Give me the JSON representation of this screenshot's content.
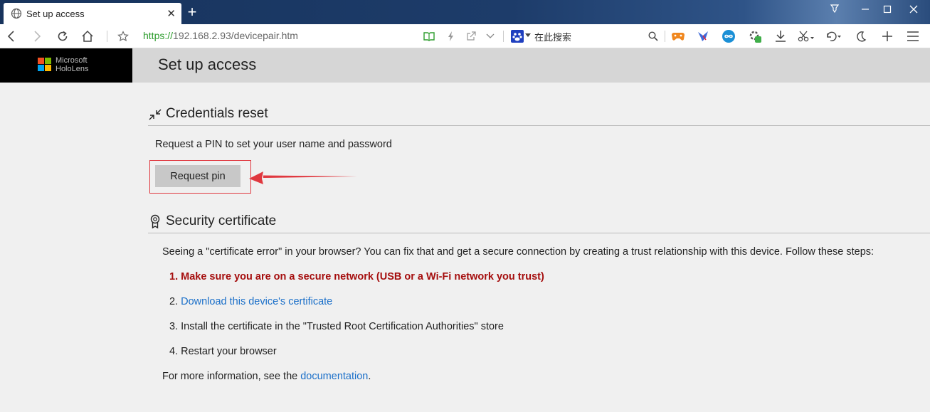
{
  "browser": {
    "tab_title": "Set up access",
    "tab_close": "✕",
    "new_tab": "+",
    "url_proto": "https://",
    "url_rest": "192.168.2.93/devicepair.htm",
    "search_placeholder": "在此搜索"
  },
  "brand": {
    "line1": "Microsoft",
    "line2": "HoloLens",
    "colors": [
      "#f25022",
      "#7fba00",
      "#00a4ef",
      "#ffb900"
    ]
  },
  "page": {
    "title": "Set up access"
  },
  "credentials": {
    "heading": "Credentials reset",
    "description": "Request a PIN to set your user name and password",
    "button_label": "Request pin"
  },
  "security": {
    "heading": "Security certificate",
    "intro": "Seeing a \"certificate error\" in your browser? You can fix that and get a secure connection by creating a trust relationship with this device. Follow these steps:",
    "step1": "1. Make sure you are on a secure network (USB or a Wi-Fi network you trust)",
    "step2_prefix": "2. ",
    "step2_link": "Download this device's certificate",
    "step3": "3. Install the certificate in the \"Trusted Root Certification Authorities\" store",
    "step4": "4. Restart your browser",
    "more_prefix": "For more information, see the ",
    "more_link": "documentation",
    "more_suffix": "."
  },
  "colors": {
    "accent_link": "#1a6fc9",
    "warning_red": "#a50e0e",
    "annotation": "#e0383f"
  }
}
